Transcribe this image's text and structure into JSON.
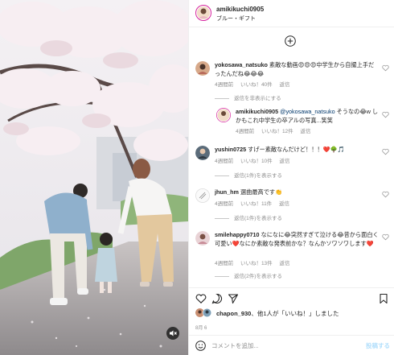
{
  "header": {
    "username": "amikikuchi0905",
    "audio": "ブルー・ギフト"
  },
  "comments": [
    {
      "username": "yokosawa_natsuko",
      "text": "素敵な動画😍😍😍中学生から自撮上手だったんだね😂😂😂",
      "time": "4週間前",
      "likes": "いいね！40件",
      "reply": "返信",
      "replies_toggle": "返信を非表示にする"
    },
    {
      "username": "amikikuchi0905",
      "mention": "@yokosawa_natsuko",
      "text": "そうなの😂w しかもこれ中学生の卒アルの写真...笑笑",
      "time": "4週間前",
      "likes": "いいね！12件",
      "reply": "返信"
    },
    {
      "username": "yushin0725",
      "text": "すげー素敵なんだけど！！！❤️🌳🎵",
      "time": "4週間前",
      "likes": "いいね！10件",
      "reply": "返信",
      "replies_toggle": "返信(1件)を表示する"
    },
    {
      "username": "jhun_hm",
      "text": "選曲最高です👏",
      "time": "4週間前",
      "likes": "いいね！11件",
      "reply": "返信",
      "replies_toggle": "返信(1件)を表示する"
    },
    {
      "username": "smilehappy0710",
      "text": "なになに😂突然すぎて泣ける😂昔から面白く可愛い❤️なにか素敵な発表前かな？なんかソワソワします❤️",
      "time": "4週間前",
      "likes": "いいね！13件",
      "reply": "返信",
      "replies_toggle": "返信(2件)を表示する"
    }
  ],
  "likes_summary": {
    "user": "chapon_930",
    "rest": "、他1人が「いいね！」しました"
  },
  "date": "8月 6",
  "comment_bar": {
    "placeholder": "コメントを追加...",
    "post_label": "投稿する"
  },
  "colors": {
    "link": "#00376b",
    "muted": "#8e8e8e",
    "post_disabled": "#b2dffc"
  }
}
